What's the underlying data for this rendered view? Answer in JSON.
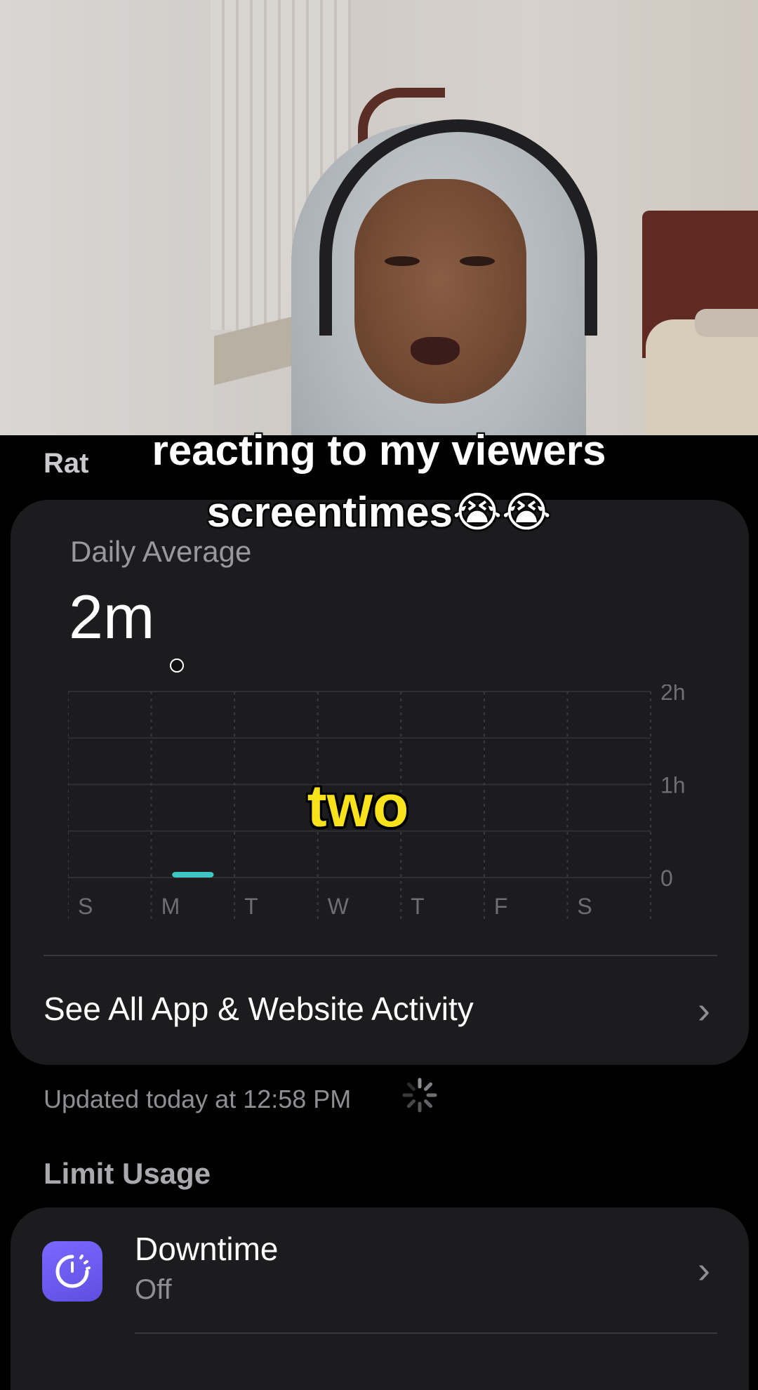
{
  "overlay": {
    "caption_line1": "reacting to my viewers",
    "caption_line2": "screentimes😭😭",
    "word_caption": "two"
  },
  "screen_time": {
    "partial_title": "Rat",
    "daily_average_label": "Daily Average",
    "daily_average_value": "2m",
    "see_all_label": "See All App & Website Activity",
    "updated_text": "Updated today at 12:58 PM",
    "limit_usage_heading": "Limit Usage",
    "downtime": {
      "title": "Downtime",
      "status": "Off",
      "icon": "downtime-icon"
    }
  },
  "chart_data": {
    "type": "bar",
    "categories": [
      "S",
      "M",
      "T",
      "W",
      "T",
      "F",
      "S"
    ],
    "values_minutes": [
      0,
      2,
      0,
      0,
      0,
      0,
      0
    ],
    "y_ticks": [
      "2h",
      "1h",
      "0"
    ],
    "ylim_minutes": [
      0,
      120
    ],
    "bar_color": "#3ec6c4",
    "grid": true
  },
  "colors": {
    "background": "#000000",
    "card": "#1c1c1e",
    "secondary_text": "#8e8e93",
    "accent_bar": "#3ec6c4",
    "caption_yellow": "#f7e21b",
    "downtime_purple": "#6c5ce7"
  }
}
